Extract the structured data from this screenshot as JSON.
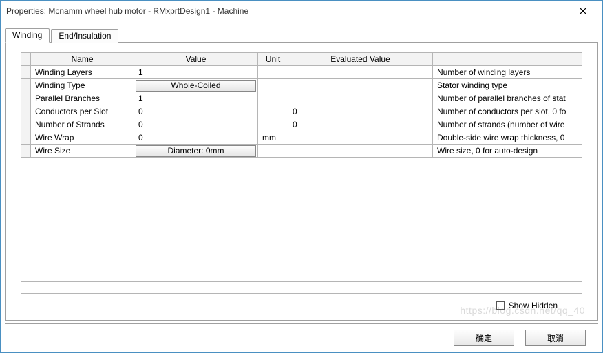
{
  "window": {
    "title": "Properties: Mcnamm wheel hub motor - RMxprtDesign1 - Machine"
  },
  "tabs": [
    {
      "label": "Winding",
      "active": true
    },
    {
      "label": "End/Insulation",
      "active": false
    }
  ],
  "grid": {
    "headers": {
      "name": "Name",
      "value": "Value",
      "unit": "Unit",
      "evaluated": "Evaluated Value",
      "desc": ""
    },
    "rows": [
      {
        "name": "Winding Layers",
        "value": "1",
        "value_is_button": false,
        "unit": "",
        "evaluated": "",
        "desc": "Number of winding layers"
      },
      {
        "name": "Winding Type",
        "value": "Whole-Coiled",
        "value_is_button": true,
        "unit": "",
        "evaluated": "",
        "desc": "Stator winding type"
      },
      {
        "name": "Parallel Branches",
        "value": "1",
        "value_is_button": false,
        "unit": "",
        "evaluated": "",
        "desc": "Number of parallel branches of stat"
      },
      {
        "name": "Conductors per Slot",
        "value": "0",
        "value_is_button": false,
        "unit": "",
        "evaluated": "0",
        "desc": "Number of conductors per slot, 0 fo"
      },
      {
        "name": "Number of Strands",
        "value": "0",
        "value_is_button": false,
        "unit": "",
        "evaluated": "0",
        "desc": "Number of strands (number of wire"
      },
      {
        "name": "Wire Wrap",
        "value": "0",
        "value_is_button": false,
        "unit": "mm",
        "evaluated": "",
        "desc": "Double-side wire wrap thickness, 0 "
      },
      {
        "name": "Wire Size",
        "value": "Diameter:  0mm",
        "value_is_button": true,
        "unit": "",
        "evaluated": "",
        "desc": "Wire size, 0 for auto-design"
      }
    ]
  },
  "footer": {
    "show_hidden_label": "Show Hidden",
    "show_hidden_checked": false
  },
  "buttons": {
    "ok": "确定",
    "cancel": "取消"
  },
  "watermark": "https://blog.csdn.net/qq_40"
}
